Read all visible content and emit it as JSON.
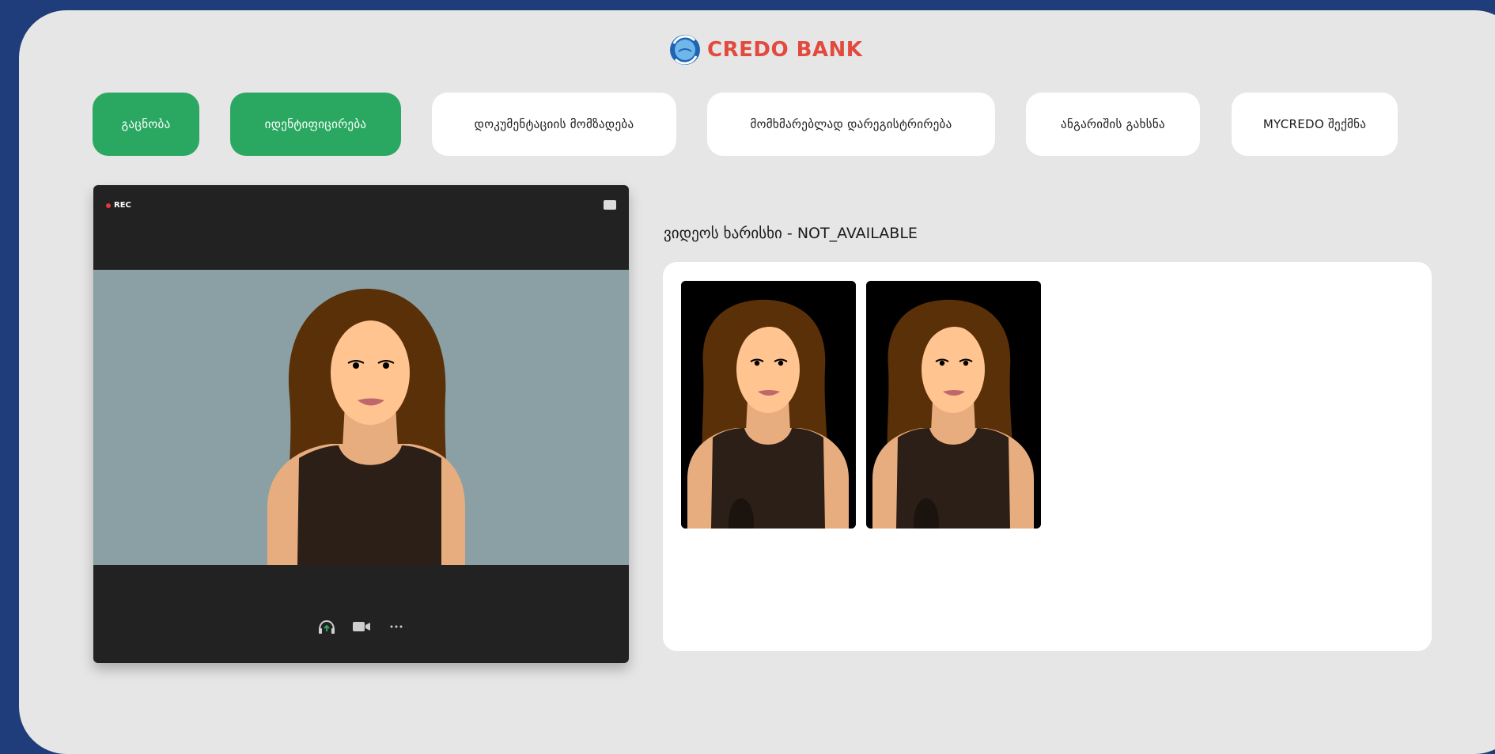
{
  "brand": {
    "name": "CREDO BANK",
    "color": "#e24a3d"
  },
  "steps": [
    {
      "label": "გაცნობა",
      "active": true
    },
    {
      "label": "იდენტიფიცირება",
      "active": true
    },
    {
      "label": "დოკუმენტაციის მომზადება",
      "active": false
    },
    {
      "label": "მომხმარებლად დარეგისტრირება",
      "active": false
    },
    {
      "label": "ანგარიშის გახსნა",
      "active": false
    },
    {
      "label": "MYCREDO შექმნა",
      "active": false
    }
  ],
  "video": {
    "rec_label": "REC",
    "icons": [
      "headset-icon",
      "camera-icon",
      "more-icon"
    ]
  },
  "quality_label": "ვიდეოს ხარისხი - NOT_AVAILABLE",
  "colors": {
    "accent_green": "#2aa862",
    "background_blue": "#1f3d7a",
    "panel_gray": "#e6e6e6"
  }
}
